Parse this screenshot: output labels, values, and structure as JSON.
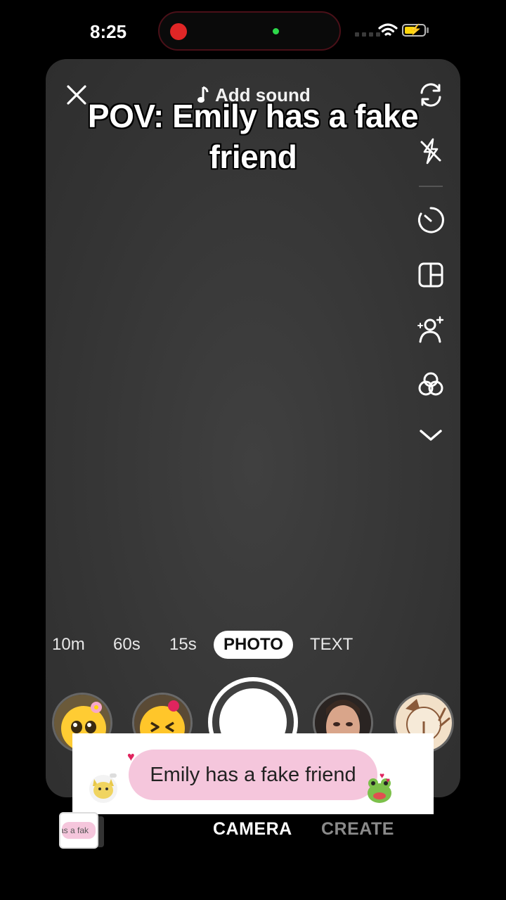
{
  "status_bar": {
    "time": "8:25"
  },
  "top_bar": {
    "add_sound_label": "Add sound"
  },
  "caption": {
    "text": "POV: Emily has a fake friend"
  },
  "side_tools": [
    {
      "icon": "flip-camera-icon"
    },
    {
      "icon": "flash-off-icon"
    },
    {
      "icon": "timer-icon"
    },
    {
      "icon": "layout-icon"
    },
    {
      "icon": "retouch-icon"
    },
    {
      "icon": "filters-icon"
    },
    {
      "icon": "chevron-down-icon"
    }
  ],
  "modes": {
    "items": [
      "10m",
      "60s",
      "15s",
      "PHOTO",
      "TEXT"
    ],
    "selected": "PHOTO"
  },
  "sticker": {
    "text": "Emily has a fake friend"
  },
  "thumbnail": {
    "text": "as a fak"
  },
  "bottom_tabs": {
    "camera": "CAMERA",
    "create": "CREATE",
    "selected": "CAMERA"
  },
  "colors": {
    "accent_red": "#e02626",
    "sticker_pink": "#f5c6dc"
  }
}
